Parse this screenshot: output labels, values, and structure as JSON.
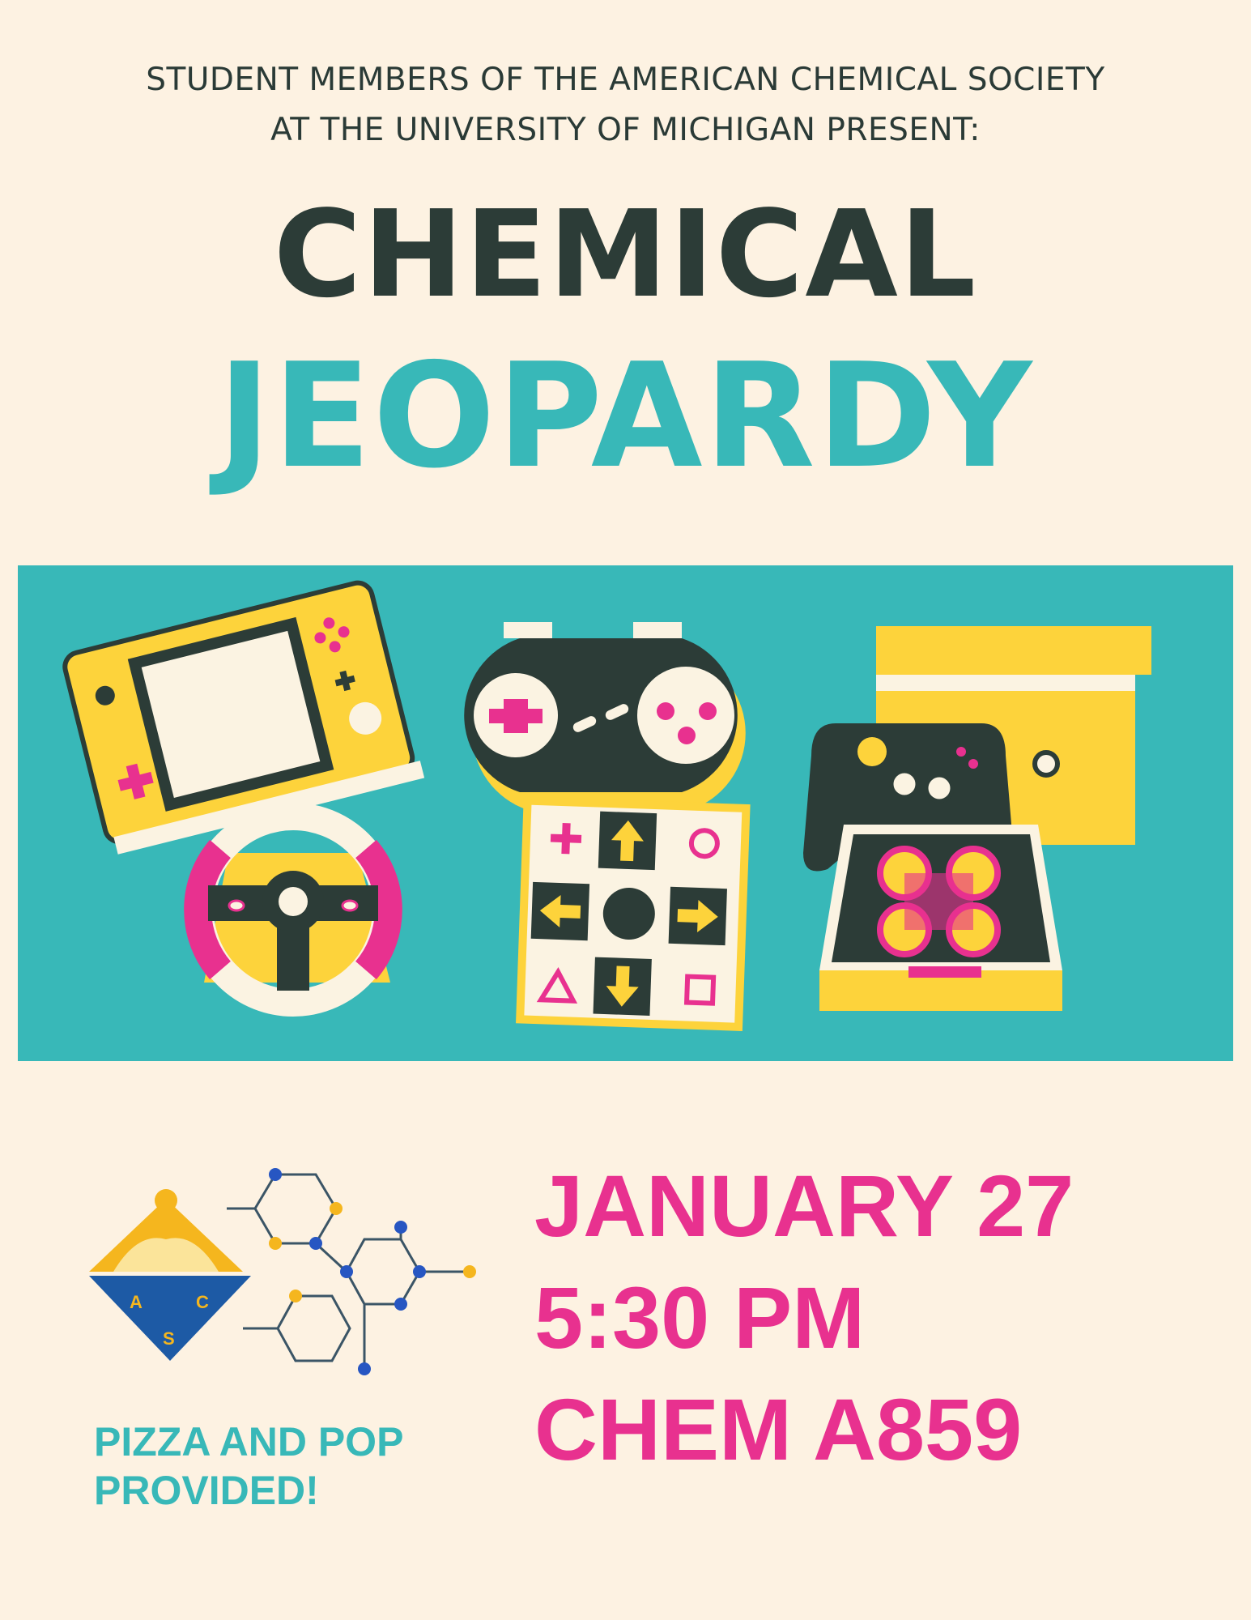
{
  "intro": {
    "line1": "STUDENT MEMBERS OF THE AMERICAN CHEMICAL SOCIETY",
    "line2": "AT THE UNIVERSITY OF MICHIGAN PRESENT:"
  },
  "title": {
    "line1": "CHEMICAL",
    "line2": "JEOPARDY"
  },
  "logo": {
    "letters": [
      "A",
      "C",
      "S"
    ]
  },
  "perks": {
    "line1": "PIZZA AND POP",
    "line2": "PROVIDED!"
  },
  "event": {
    "date": "JANUARY 27",
    "time": "5:30 PM",
    "location": "CHEM A859"
  },
  "colors": {
    "background": "#fdf2e2",
    "dark": "#2c3c37",
    "teal": "#38b8b8",
    "pink": "#e8318f",
    "yellow": "#fdd33b",
    "cream": "#fbf3e2"
  },
  "icons": [
    "handheld-console-icon",
    "gamepad-icon",
    "console-controller-icon",
    "steering-wheel-icon",
    "dance-pad-icon",
    "arcade-stick-icon"
  ]
}
